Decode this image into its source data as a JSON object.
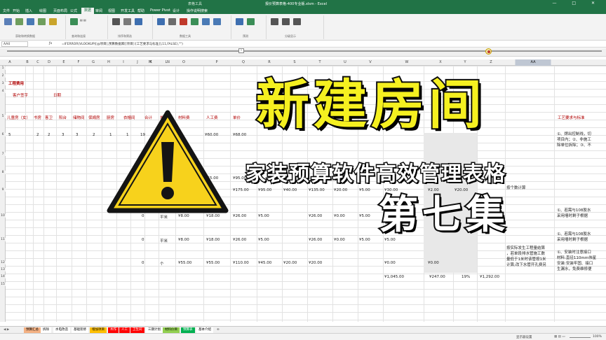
{
  "titlebar": {
    "file_title": "报价预算表格-400专业版.xlsm - Excel",
    "context": "表格工具",
    "window_controls": "— □ ✕"
  },
  "tabs": [
    "文件",
    "开始",
    "插入",
    "绘图",
    "页面布局",
    "公式",
    "数据",
    "审阅",
    "视图",
    "开发工具",
    "帮助",
    "Power Pivot",
    "设计",
    "操作说明搜索"
  ],
  "active_tab": "数据",
  "ribbon_groups": [
    "获取和转换数据",
    "查询和连接",
    "排序和筛选",
    "数据工具",
    "预测",
    "分级显示"
  ],
  "name_box": "AA4",
  "formula": "=IFERROR(VLOOKUP([@项目],预算数据库[[项目]:[工艺要求与标准]],11,FALSE),\"\")",
  "columns": [
    "A",
    "B",
    "C",
    "D",
    "E",
    "F",
    "G",
    "H",
    "I",
    "J",
    "K",
    "L",
    "M",
    "N",
    "O",
    "P",
    "Q",
    "R",
    "S",
    "T",
    "U",
    "V",
    "W",
    "X",
    "Y",
    "Z",
    "AA"
  ],
  "selected_column": "AA",
  "rows": [
    "1",
    "2",
    "3",
    "4",
    "5",
    "6",
    "7",
    "8",
    "9",
    "10",
    "11",
    "12",
    "13",
    "14",
    "15"
  ],
  "sheet": {
    "section_title": "工程费用",
    "customer_label": "客户签字",
    "date_label": "日期",
    "headers": [
      "儿童房（女）",
      "书房",
      "客卫",
      "阳台",
      "储物间",
      "保姆房",
      "厨房",
      "衣帽间",
      "合计",
      "单位",
      "材料费",
      "人工费",
      "单价",
      "工艺要求与标准"
    ],
    "row6": [
      "5",
      "2",
      "2",
      "3",
      "3",
      "2",
      "1",
      "1",
      "19",
      "",
      "¥60.00",
      "",
      "¥68.00"
    ],
    "r9": [
      "¥55.00",
      "¥95.00",
      "0",
      "¥175.00",
      "¥95.00",
      "¥40.00",
      "¥135.00",
      "¥20.00",
      "¥5.00",
      "¥30.00",
      "¥2.00",
      "¥20.00"
    ],
    "r10": [
      "0",
      "平米",
      "¥8.00",
      "¥18.00",
      "¥26.00",
      "¥5.00",
      "¥26.00",
      "¥0.00",
      "¥5.00",
      "¥5.00"
    ],
    "r11": [
      "0",
      "平米",
      "¥8.00",
      "¥18.00",
      "¥26.00",
      "¥5.00",
      "¥26.00",
      "¥0.00",
      "¥5.00",
      "¥5.00"
    ],
    "r12": [
      "0",
      "个",
      "¥55.00",
      "¥55.00",
      "¥110.00",
      "¥45.00",
      "¥20.00",
      "¥20.00",
      "¥0.00",
      "¥0.00"
    ],
    "totals": [
      "¥1,045.00",
      "¥247.00",
      "19%",
      "¥1,292.00"
    ],
    "desc_lines": [
      "①、焊出控制线，切",
      "项目内；②、非施工",
      "除单位拆除；③、不",
      "按个数计算",
      "①、若需与108胶水",
      "采用墙时剩子根据",
      "①、若需与108胶水",
      "采用墙时剩子根据",
      "①、安装时注意接口",
      "材料:直径110mm伟星",
      "安装:安装牢固、接口",
      "生漏水，免费维修便"
    ],
    "desc_bottom": [
      "按实际发生工程量结算",
      "，若单段排水管施工数",
      "量低于1米时该管按1米",
      "计算;改下水管开孔费另"
    ]
  },
  "sheet_tabs": [
    "预算汇总",
    "拆除",
    "水电改造",
    "基础装修",
    "增加项目",
    "木作",
    "人工",
    "卫生间",
    "三期计划",
    "材料价目",
    "预算表",
    "基本介绍"
  ],
  "sheet_tab_colors": [
    "#f4b183",
    "#ffffff",
    "#ffffff",
    "#ffffff",
    "#ffc000",
    "#ff0000",
    "#ff0000",
    "#ff0000",
    "#ffffff",
    "#92d050",
    "#00b050",
    "#ffffff"
  ],
  "status": {
    "display_settings": "显示器设置",
    "zoom": "100%"
  },
  "overlay": {
    "title": "新建房间",
    "subtitle": "家装预算软件高效管理表格",
    "episode": "第七集"
  },
  "icons": [
    "warning-icon",
    "cursor-icon"
  ]
}
